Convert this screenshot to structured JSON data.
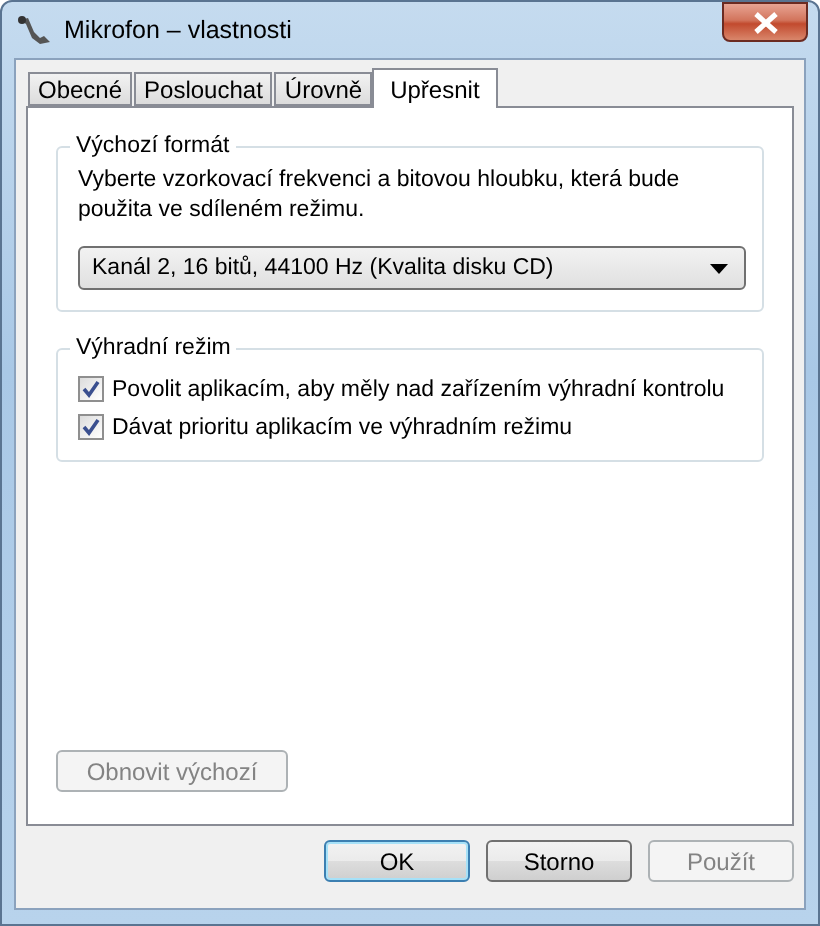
{
  "window": {
    "title": "Mikrofon – vlastnosti"
  },
  "tabs": [
    {
      "label": "Obecné",
      "selected": false
    },
    {
      "label": "Poslouchat",
      "selected": false
    },
    {
      "label": "Úrovně",
      "selected": false
    },
    {
      "label": "Upřesnit",
      "selected": true
    }
  ],
  "default_format": {
    "title": "Výchozí formát",
    "description": "Vyberte vzorkovací frekvenci a bitovou hloubku, která bude použita ve sdíleném režimu.",
    "dropdown_value": "Kanál 2, 16 bitů, 44100 Hz (Kvalita disku CD)"
  },
  "exclusive_mode": {
    "title": "Výhradní režim",
    "options": [
      {
        "label": "Povolit aplikacím, aby měly nad zařízením výhradní kontrolu",
        "checked": true
      },
      {
        "label": "Dávat prioritu aplikacím ve výhradním režimu",
        "checked": true
      }
    ]
  },
  "restore_button": {
    "label": "Obnovit výchozí",
    "disabled": true
  },
  "buttons": [
    {
      "label": "OK",
      "disabled": false,
      "default": true
    },
    {
      "label": "Storno",
      "disabled": false,
      "default": false
    },
    {
      "label": "Použít",
      "disabled": true,
      "default": false
    }
  ]
}
